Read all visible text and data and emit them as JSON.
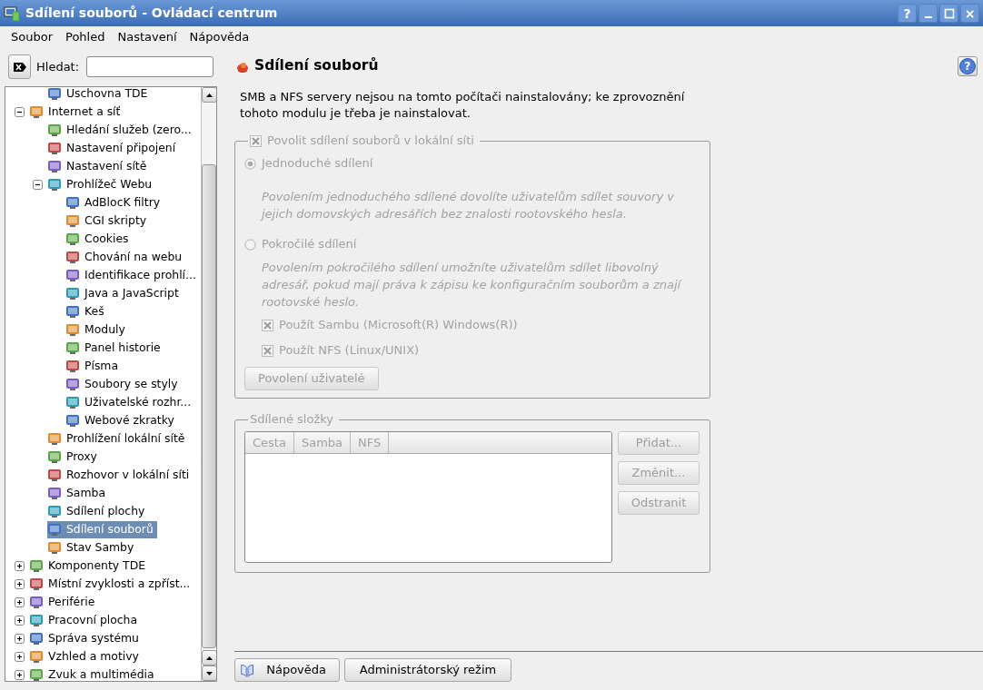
{
  "window": {
    "title": "Sdílení souborů - Ovládací centrum",
    "help_button": "?",
    "close_button": "×"
  },
  "menu": [
    "Soubor",
    "Pohled",
    "Nastavení",
    "Nápověda"
  ],
  "search": {
    "label": "Hledat:"
  },
  "tree": {
    "partial_item": "Uschovna TDE",
    "items": [
      {
        "label": "Internet a síť",
        "expanded": true,
        "selected": false,
        "children": [
          {
            "label": "Hledání služeb (zero...",
            "selected": false
          },
          {
            "label": "Nastavení připojení",
            "selected": false
          },
          {
            "label": "Nastavení sítě",
            "selected": false
          },
          {
            "label": "Prohlížeč Webu",
            "expanded": true,
            "selected": false,
            "children": [
              {
                "label": "AdBlocK filtry",
                "selected": false
              },
              {
                "label": "CGI skripty",
                "selected": false
              },
              {
                "label": "Cookies",
                "selected": false
              },
              {
                "label": "Chování na webu",
                "selected": false
              },
              {
                "label": "Identifikace prohlí...",
                "selected": false
              },
              {
                "label": "Java a JavaScript",
                "selected": false
              },
              {
                "label": "Keš",
                "selected": false
              },
              {
                "label": "Moduly",
                "selected": false
              },
              {
                "label": "Panel historie",
                "selected": false
              },
              {
                "label": "Písma",
                "selected": false
              },
              {
                "label": "Soubory se styly",
                "selected": false
              },
              {
                "label": "Uživatelské rozhr...",
                "selected": false
              },
              {
                "label": "Webové zkratky",
                "selected": false
              }
            ]
          },
          {
            "label": "Prohlížení lokální sítě",
            "selected": false
          },
          {
            "label": "Proxy",
            "selected": false
          },
          {
            "label": "Rozhovor v lokální síti",
            "selected": false
          },
          {
            "label": "Samba",
            "selected": false
          },
          {
            "label": "Sdílení plochy",
            "selected": false
          },
          {
            "label": "Sdílení souborů",
            "selected": true
          },
          {
            "label": "Stav Samby",
            "selected": false
          }
        ]
      },
      {
        "label": "Komponenty TDE",
        "expanded": false,
        "selected": false
      },
      {
        "label": "Místní zvyklosti a zpříst...",
        "expanded": false,
        "selected": false
      },
      {
        "label": "Periférie",
        "expanded": false,
        "selected": false
      },
      {
        "label": "Pracovní plocha",
        "expanded": false,
        "selected": false
      },
      {
        "label": "Správa systému",
        "expanded": false,
        "selected": false
      },
      {
        "label": "Vzhled a motivy",
        "expanded": false,
        "selected": false
      },
      {
        "label": "Zvuk a multimédia",
        "expanded": false,
        "selected": false
      }
    ]
  },
  "module": {
    "title": "Sdílení souborů",
    "help_button": "?",
    "message": "SMB a NFS servery nejsou na tomto počítači nainstalovány; ke zprovoznění tohoto modulu je třeba je nainstalovat.",
    "sharing_group": {
      "label": "Povolit sdílení souborů v lokální síti",
      "checked": true,
      "disabled": true,
      "options": [
        {
          "label": "Jednoduché sdílení",
          "selected": true,
          "description": "Povolením jednoduchého sdílené dovolíte uživatelům sdílet souvory v jejich domovských adresářích bez znalosti rootovského hesla."
        },
        {
          "label": "Pokročilé sdílení",
          "selected": false,
          "description": "Povolením pokročilého sdílení umožníte uživatelům sdílet libovolný adresář, pokud mají práva k zápisu ke konfiguračním souborům a znají rootovské heslo."
        }
      ],
      "checks": [
        {
          "label": "Použít Sambu (Microsoft(R) Windows(R))",
          "checked": true
        },
        {
          "label": "Použít NFS (Linux/UNIX)",
          "checked": true
        }
      ],
      "button": "Povolení uživatelé"
    },
    "folders_group": {
      "title": "Sdílené složky",
      "disabled": true,
      "columns": [
        "Cesta",
        "Samba",
        "NFS"
      ],
      "buttons": [
        "Přidat...",
        "Změnit...",
        "Odstranit"
      ]
    }
  },
  "footer_buttons": [
    "Nápověda",
    "Administrátorský režim"
  ]
}
